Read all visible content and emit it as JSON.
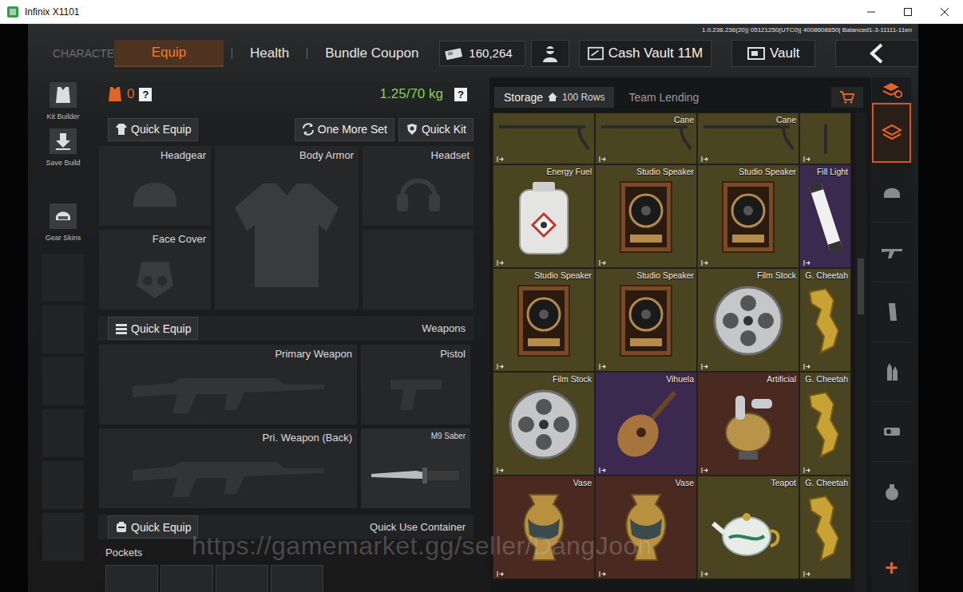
{
  "window": {
    "title": "Infinix X1101"
  },
  "build_info": "1.0.236.236(20)| 05121250(UTC0)| 4008608850| Balanced1-3-11111-11en",
  "top_bar": {
    "section": "CHARACTER",
    "tabs": [
      {
        "label": "Equip",
        "selected": true
      },
      {
        "label": "Health",
        "selected": false
      },
      {
        "label": "Bundle Coupon",
        "selected": false
      }
    ],
    "currency": "160,264",
    "buttons": [
      {
        "label": "Cash Vault 11M",
        "kind": "cash-vault"
      },
      {
        "label": "Vault",
        "kind": "vault"
      }
    ]
  },
  "sidebar": {
    "items": [
      {
        "label": "Kit Builder",
        "kind": "kit"
      },
      {
        "label": "Save Build",
        "kind": "save"
      },
      {
        "label": "Gear Skins",
        "kind": "skins"
      }
    ]
  },
  "equip": {
    "armor_count": "0",
    "help": "?",
    "weight": "1.25/70 kg",
    "actions": [
      {
        "label": "Quick Equip",
        "kind": "gear"
      },
      {
        "label": "One More Set",
        "kind": "swap"
      },
      {
        "label": "Quick Kit",
        "kind": "kit"
      }
    ],
    "gear_slots": [
      {
        "label": "Headgear",
        "kind": "headgear"
      },
      {
        "label": "Body Armor",
        "kind": "armor"
      },
      {
        "label": "Headset",
        "kind": "headset"
      },
      {
        "label": "Face Cover",
        "kind": "face"
      }
    ],
    "weapons": {
      "button": "Quick Equip",
      "title": "Weapons",
      "slots": [
        {
          "label": "Primary Weapon",
          "kind": "rifle",
          "filled": false
        },
        {
          "label": "Pistol",
          "kind": "pistol",
          "filled": false
        },
        {
          "label": "Pri. Weapon (Back)",
          "kind": "rifle-back",
          "filled": false
        },
        {
          "label": "M9 Saber",
          "kind": "knife",
          "filled": true
        }
      ]
    },
    "container": {
      "button": "Quick Equip",
      "title": "Quick Use Container"
    },
    "pockets": {
      "title": "Pockets"
    }
  },
  "storage": {
    "tabs": [
      {
        "label": "Storage",
        "badge": "100 Rows",
        "selected": true
      },
      {
        "label": "Team Lending",
        "selected": false
      }
    ],
    "items": [
      {
        "kind": "cane",
        "color": "#4a4421"
      },
      {
        "name": "Cane",
        "kind": "cane",
        "color": "#4a4421"
      },
      {
        "name": "Cane",
        "kind": "cane",
        "color": "#4a4421"
      },
      {
        "kind": "cane-v",
        "color": "#4a4421"
      },
      {
        "name": "Energy Fuel",
        "kind": "fuel",
        "color": "#4a4421"
      },
      {
        "name": "Studio Speaker",
        "kind": "speaker",
        "color": "#4a4421"
      },
      {
        "name": "Studio Speaker",
        "kind": "speaker",
        "color": "#4a4421"
      },
      {
        "name": "Fill Light",
        "kind": "light",
        "color": "#3b2950"
      },
      {
        "name": "Studio Speaker",
        "kind": "speaker",
        "color": "#4a4421"
      },
      {
        "name": "Studio Speaker",
        "kind": "speaker",
        "color": "#4a4421"
      },
      {
        "name": "Film Stock",
        "kind": "film",
        "color": "#4a4421"
      },
      {
        "name": "G. Cheetah",
        "kind": "cheetah",
        "color": "#4a4421"
      },
      {
        "name": "Film Stock",
        "kind": "film",
        "color": "#4a4421"
      },
      {
        "name": "Vihuela",
        "kind": "guitar",
        "color": "#3b2950"
      },
      {
        "name": "Artificial",
        "kind": "artificial",
        "color": "#4a2a20"
      },
      {
        "name": "G. Cheetah",
        "kind": "cheetah",
        "color": "#4a4421"
      },
      {
        "name": "Vase",
        "kind": "vase",
        "color": "#4a2a20"
      },
      {
        "name": "Vase",
        "kind": "vase",
        "color": "#4a2a20"
      },
      {
        "name": "Teapot",
        "kind": "teapot",
        "color": "#4a4421"
      },
      {
        "name": "G. Cheetah",
        "kind": "cheetah",
        "color": "#4a4421"
      }
    ]
  },
  "categories": [
    {
      "kind": "sort",
      "selected": false
    },
    {
      "kind": "all",
      "selected": true
    },
    {
      "kind": "gear",
      "selected": false
    },
    {
      "kind": "weapon",
      "selected": false
    },
    {
      "kind": "magazine",
      "selected": false
    },
    {
      "kind": "ammo",
      "selected": false
    },
    {
      "kind": "attachment",
      "selected": false
    },
    {
      "kind": "medical",
      "selected": false
    }
  ],
  "add": "+",
  "watermark": "https://gamemarket.gg/seller/DangJoon"
}
